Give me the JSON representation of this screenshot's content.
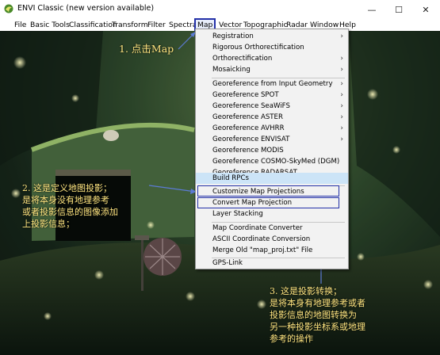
{
  "window": {
    "title": "ENVI Classic (new version available)",
    "controls": {
      "minimize": "—",
      "maximize": "☐",
      "close": "✕"
    }
  },
  "menubar": {
    "items": [
      "File",
      "Basic Tools",
      "Classification",
      "Transform",
      "Filter",
      "Spectral",
      "Map",
      "Vector",
      "Topographic",
      "Radar",
      "Window",
      "Help"
    ],
    "active": "Map"
  },
  "map_menu": {
    "items": [
      {
        "label": "Registration",
        "submenu": true
      },
      {
        "label": "Rigorous Orthorectification",
        "submenu": false
      },
      {
        "label": "Orthorectification",
        "submenu": true
      },
      {
        "label": "Mosaicking",
        "submenu": true
      },
      {
        "label": "Georeference from Input Geometry",
        "submenu": true
      },
      {
        "label": "Georeference SPOT",
        "submenu": true
      },
      {
        "label": "Georeference SeaWiFS",
        "submenu": true
      },
      {
        "label": "Georeference ASTER",
        "submenu": true
      },
      {
        "label": "Georeference AVHRR",
        "submenu": true
      },
      {
        "label": "Georeference ENVISAT",
        "submenu": true
      },
      {
        "label": "Georeference MODIS",
        "submenu": false
      },
      {
        "label": "Georeference COSMO-SkyMed (DGM)",
        "submenu": false
      },
      {
        "label": "Georeference RADARSAT",
        "submenu": false
      },
      {
        "label": "Build RPCs",
        "submenu": false
      },
      {
        "label": "Customize Map Projections",
        "submenu": false
      },
      {
        "label": "Convert Map Projection",
        "submenu": false
      },
      {
        "label": "Layer Stacking",
        "submenu": false
      },
      {
        "label": "Map Coordinate Converter",
        "submenu": false
      },
      {
        "label": "ASCII Coordinate Conversion",
        "submenu": false
      },
      {
        "label": "Merge Old \"map_proj.txt\" File",
        "submenu": false
      },
      {
        "label": "GPS-Link",
        "submenu": false
      }
    ],
    "highlighted": "Build RPCs",
    "submenu_arrow": "›"
  },
  "annotations": {
    "step1": "1. 点击Map",
    "step2": [
      "2. 这是定义地图投影；",
      "是将本身没有地理参考",
      "或者投影信息的图像添加",
      "上投影信息；"
    ],
    "step3": [
      "3. 这是投影转换；",
      "是将本身有地理参考或者",
      "投影信息的地图转换为",
      "另一种投影坐标系或地理",
      "参考的操作"
    ]
  },
  "colors": {
    "annotation_text": "#ffe680",
    "annotation_outline": "#2330a8",
    "highlight": "#cce4f7",
    "menu_bg": "#f2f2f2"
  }
}
